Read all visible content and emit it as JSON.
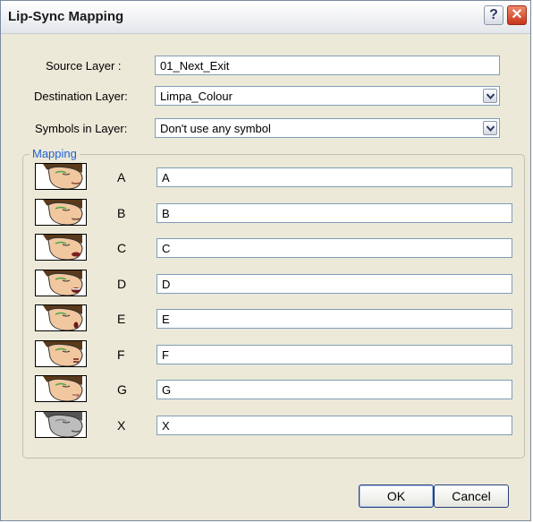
{
  "window": {
    "title": "Lip-Sync Mapping",
    "help_glyph": "?",
    "close_glyph": "✕"
  },
  "form": {
    "source_layer_label": "Source Layer :",
    "source_layer_value": "01_Next_Exit",
    "destination_layer_label": "Destination Layer:",
    "destination_layer_value": "Limpa_Colour",
    "symbols_label": "Symbols in Layer:",
    "symbols_value": "Don't use any symbol"
  },
  "mapping": {
    "group_label": "Mapping",
    "rows": [
      {
        "letter": "A",
        "value": "A",
        "icon": "mouth-a-thumbnail-icon"
      },
      {
        "letter": "B",
        "value": "B",
        "icon": "mouth-b-thumbnail-icon"
      },
      {
        "letter": "C",
        "value": "C",
        "icon": "mouth-c-thumbnail-icon"
      },
      {
        "letter": "D",
        "value": "D",
        "icon": "mouth-d-thumbnail-icon"
      },
      {
        "letter": "E",
        "value": "E",
        "icon": "mouth-e-thumbnail-icon"
      },
      {
        "letter": "F",
        "value": "F",
        "icon": "mouth-f-thumbnail-icon"
      },
      {
        "letter": "G",
        "value": "G",
        "icon": "mouth-g-thumbnail-icon"
      },
      {
        "letter": "X",
        "value": "X",
        "icon": "mouth-x-thumbnail-icon"
      }
    ]
  },
  "buttons": {
    "ok_label": "OK",
    "cancel_label": "Cancel"
  },
  "colors": {
    "dialog_bg": "#ece9d8",
    "group_label": "#1f5fd6",
    "field_border": "#7f9db9",
    "close_button": "#c8341a"
  }
}
